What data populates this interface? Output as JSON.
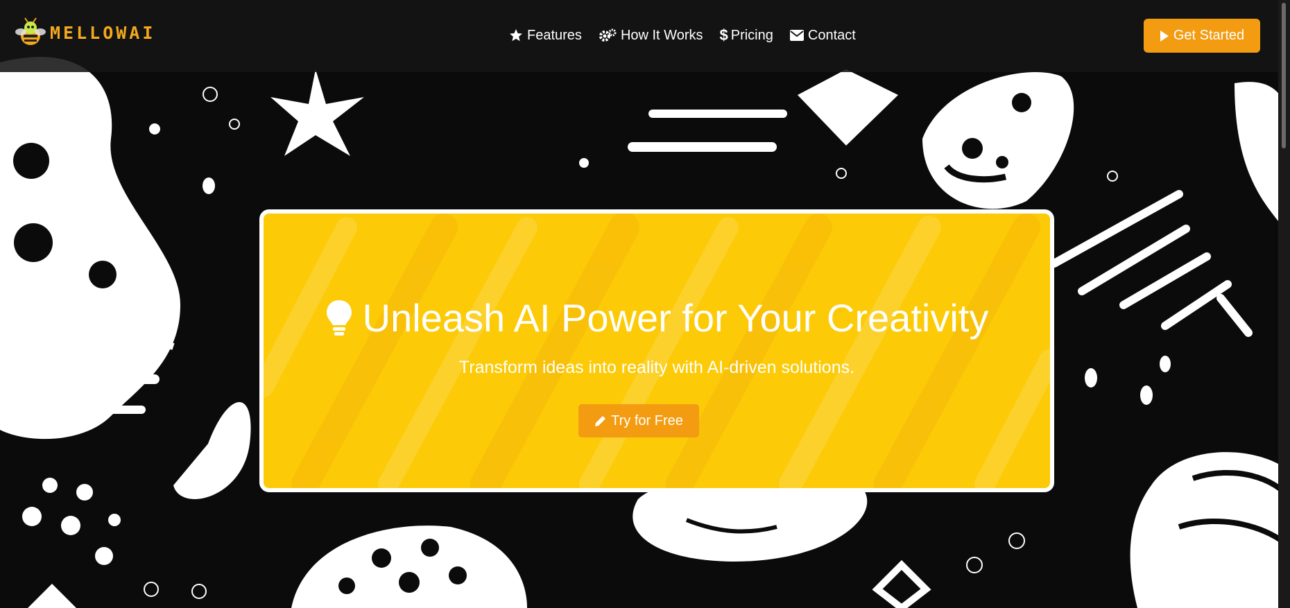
{
  "brand": {
    "name": "MELLOWAI",
    "logo_icon": "bee-icon",
    "accent": "#f4a91c"
  },
  "nav": {
    "links": [
      {
        "label": "Features",
        "icon": "star-icon"
      },
      {
        "label": "How It Works",
        "icon": "cogs-icon"
      },
      {
        "label": "Pricing",
        "icon": "dollar-icon"
      },
      {
        "label": "Contact",
        "icon": "envelope-icon"
      }
    ],
    "cta_label": "Get Started",
    "cta_icon": "play-icon"
  },
  "hero": {
    "title": "Unleash AI Power for Your Creativity",
    "title_icon": "lightbulb-icon",
    "subtitle": "Transform ideas into reality with AI-driven solutions.",
    "button_label": "Try for Free",
    "button_icon": "pencil-icon"
  },
  "colors": {
    "primary_button": "#f39c12",
    "hero_background": "#fcca06",
    "page_background": "#0b0b0b"
  }
}
